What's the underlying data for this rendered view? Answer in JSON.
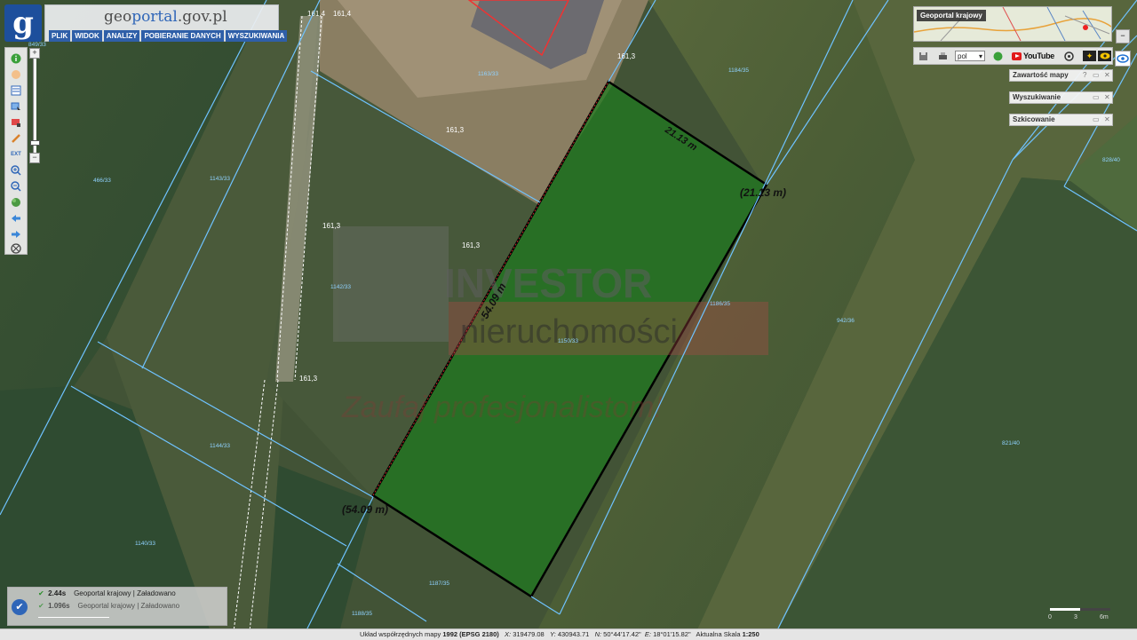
{
  "header": {
    "logo_letter": "g",
    "brand": {
      "prefix": "geo",
      "accent": "portal",
      "suffix": ".gov.pl"
    },
    "menu": [
      "PLIK",
      "WIDOK",
      "ANALIZY",
      "POBIERANIE DANYCH",
      "WYSZUKIWANIA"
    ]
  },
  "toolbar": {
    "tools": [
      "info-icon",
      "pan-hand-icon",
      "layers-icon",
      "select-area-icon",
      "measure-delete-icon",
      "pencil-icon",
      "extent-icon",
      "zoom-in-icon",
      "zoom-out-icon",
      "globe-icon",
      "back-icon",
      "forward-icon",
      "print-settings-icon"
    ],
    "extent_label": "EXT",
    "zoom": {
      "plus": "+",
      "minus": "−"
    }
  },
  "right_panel": {
    "overview_title": "Geoportal krajowy",
    "toolstrip": {
      "language": "pol",
      "youtube_label": "YouTube"
    },
    "panels": [
      "Zawartość mapy",
      "Wyszukiwanie",
      "Szkicowanie"
    ],
    "panel_help": "?"
  },
  "map": {
    "plot_area_label": "54.09 m",
    "plot_area_label_paren": "(54.09 m)",
    "plot_width_label": "21.13 m",
    "plot_width_label_paren": "(21.13 m)",
    "watermark_brand": "INVESTOR",
    "watermark_sub": "nieruchomości",
    "watermark_slogan": "Zaufaj profesjonalistom!",
    "elevations": [
      "161,4",
      "161,4",
      "161,3",
      "161,3",
      "161,3",
      "161,3",
      "161,3"
    ],
    "parcels": [
      "1143/33",
      "1142/33",
      "1144/33",
      "1140/33",
      "1150/33",
      "1186/35",
      "1184/35",
      "1187/35",
      "1188/35",
      "849/33",
      "466/33",
      "942/36",
      "821/40",
      "828/40",
      "1163/33"
    ]
  },
  "status": {
    "rows": [
      {
        "time": "2.44s",
        "source": "Geoportal krajowy",
        "state": "Załadowano"
      },
      {
        "time": "1.096s",
        "source": "Geoportal krajowy",
        "state": "Załadowano"
      }
    ]
  },
  "bottombar": {
    "system_label": "Układ współrzędnych mapy",
    "system_value": "1992 (EPSG 2180)",
    "x_label": "X:",
    "x_value": "319479.08",
    "y_label": "Y:",
    "y_value": "430943.71",
    "n_label": "N:",
    "n_value": "50°44'17.42\"",
    "e_label": "E:",
    "e_value": "18°01'15.82\"",
    "scale_label": "Aktualna Skala",
    "scale_value": "1:250"
  },
  "scalebar": {
    "ticks": [
      "0",
      "3",
      "6m"
    ]
  },
  "colors": {
    "parcel_line": "#6fc3ff",
    "plot_fill": "#1f7a1f",
    "brand_blue": "#1d4f9c"
  }
}
